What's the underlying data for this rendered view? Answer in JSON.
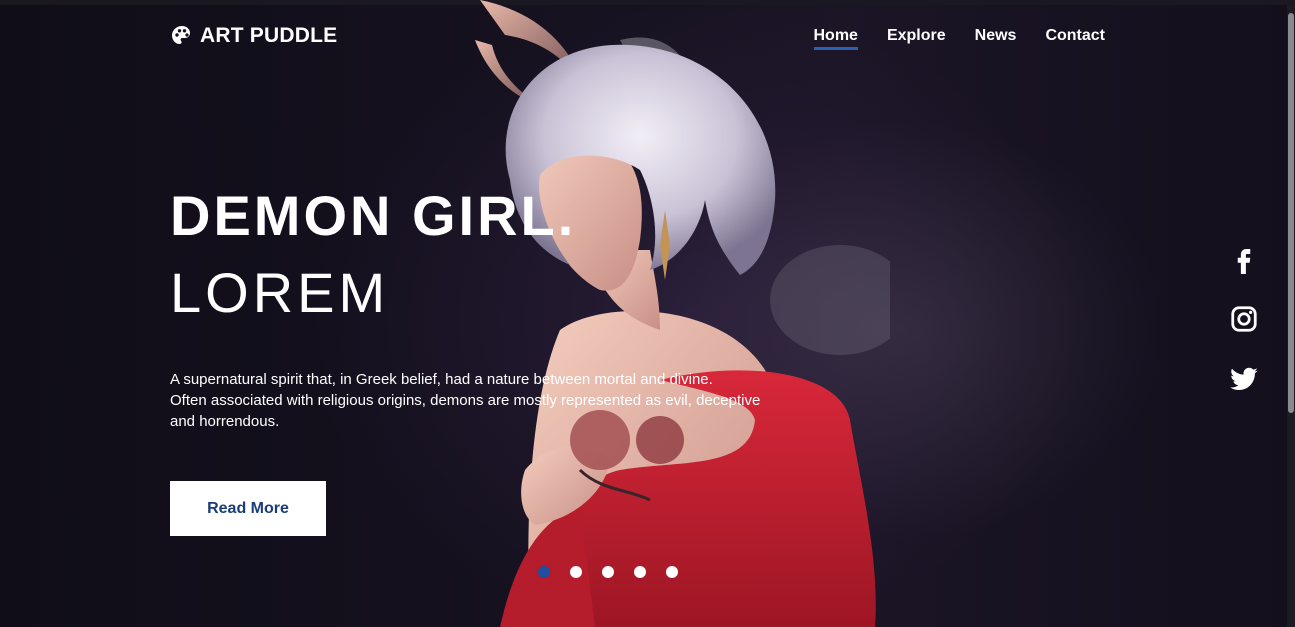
{
  "brand": {
    "name": "ART PUDDLE",
    "icon": "palette-icon"
  },
  "nav": {
    "items": [
      {
        "label": "Home",
        "active": true
      },
      {
        "label": "Explore",
        "active": false
      },
      {
        "label": "News",
        "active": false
      },
      {
        "label": "Contact",
        "active": false
      }
    ]
  },
  "hero": {
    "title_line1": "DEMON GIRL.",
    "title_line2": "LOREM",
    "description_line1": "A supernatural spirit that, in Greek belief, had a nature between mortal and divine.",
    "description_line2": "Often associated with religious origins, demons are mostly represented as evil, deceptive",
    "description_line3": "and horrendous.",
    "button_label": "Read More"
  },
  "slider": {
    "count": 5,
    "active_index": 0
  },
  "social": [
    "facebook-icon",
    "instagram-icon",
    "twitter-icon"
  ],
  "colors": {
    "accent": "#1f4fa0",
    "button_text": "#1a3c7a",
    "background": "#120f1a",
    "kimono": "#c8202f"
  }
}
